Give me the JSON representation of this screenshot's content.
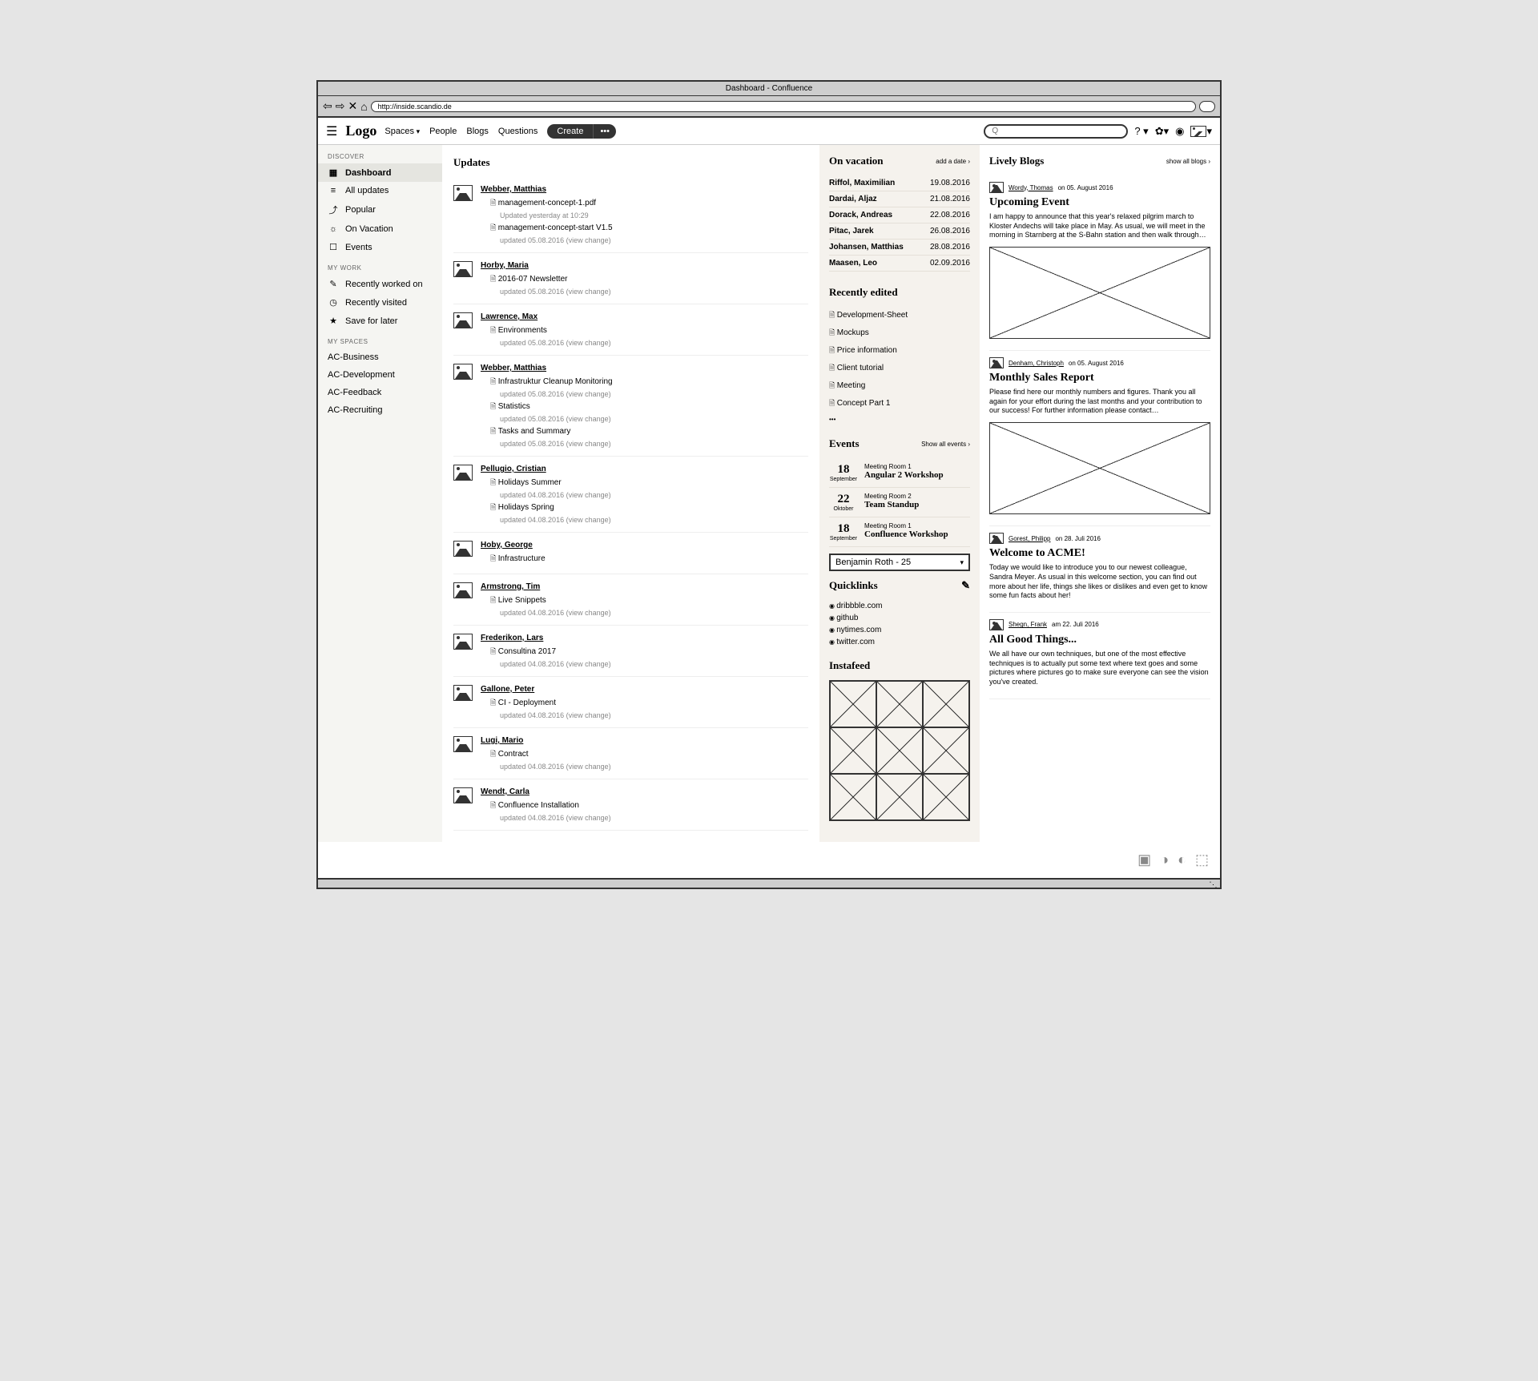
{
  "browser": {
    "title": "Dashboard - Confluence",
    "url": "http://inside.scandio.de"
  },
  "header": {
    "logo": "Logo",
    "nav": [
      "Spaces",
      "People",
      "Blogs",
      "Questions"
    ],
    "create": "Create",
    "help": "? ▾",
    "search_placeholder": "Q"
  },
  "sidebar": {
    "discover_heading": "DISCOVER",
    "discover": [
      {
        "label": "Dashboard",
        "icon": "▦"
      },
      {
        "label": "All updates",
        "icon": "≡"
      },
      {
        "label": "Popular",
        "icon": "⤴"
      },
      {
        "label": "On Vacation",
        "icon": "☼"
      },
      {
        "label": "Events",
        "icon": "☐"
      }
    ],
    "mywork_heading": "MY WORK",
    "mywork": [
      {
        "label": "Recently worked on",
        "icon": "✎"
      },
      {
        "label": "Recently visited",
        "icon": "◷"
      },
      {
        "label": "Save for later",
        "icon": "★"
      }
    ],
    "myspaces_heading": "MY SPACES",
    "myspaces": [
      "AC-Business",
      "AC-Development",
      "AC-Feedback",
      "AC-Recruiting"
    ]
  },
  "updates": {
    "title": "Updates",
    "items": [
      {
        "author": "Webber, Matthias",
        "docs": [
          {
            "title": "management-concept-1.pdf",
            "meta": "Updated yesterday at 10:29"
          },
          {
            "title": "management-concept-start V1.5",
            "meta": "updated 05.08.2016 (view change)"
          }
        ]
      },
      {
        "author": "Horby, Maria",
        "docs": [
          {
            "title": "2016-07 Newsletter",
            "meta": "updated 05.08.2016 (view change)"
          }
        ]
      },
      {
        "author": "Lawrence, Max",
        "docs": [
          {
            "title": "Environments",
            "meta": "updated 05.08.2016 (view change)"
          }
        ]
      },
      {
        "author": "Webber, Matthias",
        "docs": [
          {
            "title": "Infrastruktur Cleanup Monitoring",
            "meta": "updated 05.08.2016 (view change)"
          },
          {
            "title": "Statistics",
            "meta": "updated 05.08.2016 (view change)"
          },
          {
            "title": "Tasks and Summary",
            "meta": "updated 05.08.2016 (view change)"
          }
        ]
      },
      {
        "author": "Pellugio, Cristian",
        "docs": [
          {
            "title": "Holidays Summer",
            "meta": "updated 04.08.2016 (view change)"
          },
          {
            "title": "Holidays Spring",
            "meta": "updated 04.08.2016 (view change)"
          }
        ]
      },
      {
        "author": "Hoby, George",
        "docs": [
          {
            "title": "Infrastructure",
            "meta": ""
          }
        ]
      },
      {
        "author": "Armstrong, Tim",
        "docs": [
          {
            "title": "Live Snippets",
            "meta": "updated 04.08.2016 (view change)"
          }
        ]
      },
      {
        "author": "Frederikon, Lars",
        "docs": [
          {
            "title": "Consultina 2017",
            "meta": "updated 04.08.2016 (view change)"
          }
        ]
      },
      {
        "author": "Gallone, Peter",
        "docs": [
          {
            "title": "CI - Deployment",
            "meta": "updated 04.08.2016 (view change)"
          }
        ]
      },
      {
        "author": "Lugi, Mario",
        "docs": [
          {
            "title": "Contract",
            "meta": "updated 04.08.2016 (view change)"
          }
        ]
      },
      {
        "author": "Wendt, Carla",
        "docs": [
          {
            "title": "Confluence Installation",
            "meta": "updated 04.08.2016 (view change)"
          }
        ]
      }
    ]
  },
  "vacation": {
    "title": "On vacation",
    "link": "add a date",
    "items": [
      {
        "name": "Riffol, Maximilian",
        "date": "19.08.2016"
      },
      {
        "name": "Dardai, Aljaz",
        "date": "21.08.2016"
      },
      {
        "name": "Dorack, Andreas",
        "date": "22.08.2016"
      },
      {
        "name": "Pitac, Jarek",
        "date": "26.08.2016"
      },
      {
        "name": "Johansen, Matthias",
        "date": "28.08.2016"
      },
      {
        "name": "Maasen, Leo",
        "date": "02.09.2016"
      }
    ]
  },
  "recent": {
    "title": "Recently edited",
    "items": [
      "Development-Sheet",
      "Mockups",
      "Price information",
      "Client tutorial",
      "Meeting",
      "Concept Part 1"
    ],
    "more": "•••"
  },
  "events": {
    "title": "Events",
    "link": "Show all events",
    "items": [
      {
        "day": "18",
        "month": "September",
        "room": "Meeting Room 1",
        "title": "Angular 2 Workshop"
      },
      {
        "day": "22",
        "month": "Oktober",
        "room": "Meeting Room 2",
        "title": "Team Standup"
      },
      {
        "day": "18",
        "month": "September",
        "room": "Meeting Room 1",
        "title": "Confluence Workshop"
      }
    ]
  },
  "person_select": "Benjamin Roth - 25",
  "quicklinks": {
    "title": "Quicklinks",
    "items": [
      "dribbble.com",
      "github",
      "nytimes.com",
      "twitter.com"
    ]
  },
  "instafeed": {
    "title": "Instafeed"
  },
  "blogs": {
    "title": "Lively Blogs",
    "link": "show all blogs",
    "posts": [
      {
        "author": "Wordy, Thomas",
        "date": "on 05. August 2016",
        "title": "Upcoming Event",
        "excerpt": "I am happy to announce that this year's relaxed pilgrim march to Kloster Andechs will take place in May. As usual, we will meet in the morning in Starnberg at the S-Bahn station and then walk through…",
        "image": true
      },
      {
        "author": "Denham, Christoph",
        "date": "on 05. August 2016",
        "title": "Monthly Sales Report",
        "excerpt": "Please find here our monthly numbers and figures. Thank you all again for your effort during the last months and your contribution to our success! For further information please contact…",
        "image": true
      },
      {
        "author": "Gorest, Philipp",
        "date": "on 28. Juli 2016",
        "title": "Welcome to ACME!",
        "excerpt": "Today we would like to introduce you to our newest colleague, Sandra Meyer. As usual in this welcome section, you can find out more about her life, things she likes or dislikes and even get to know some fun facts about her!",
        "image": false
      },
      {
        "author": "Shegn, Frank",
        "date": "am 22. Juli 2016",
        "title": "All Good Things...",
        "excerpt": "We all have our own techniques, but one of the most effective techniques is to actually put some text where text goes and some pictures where pictures go to make sure everyone can see the vision you've created.",
        "image": false
      }
    ]
  }
}
